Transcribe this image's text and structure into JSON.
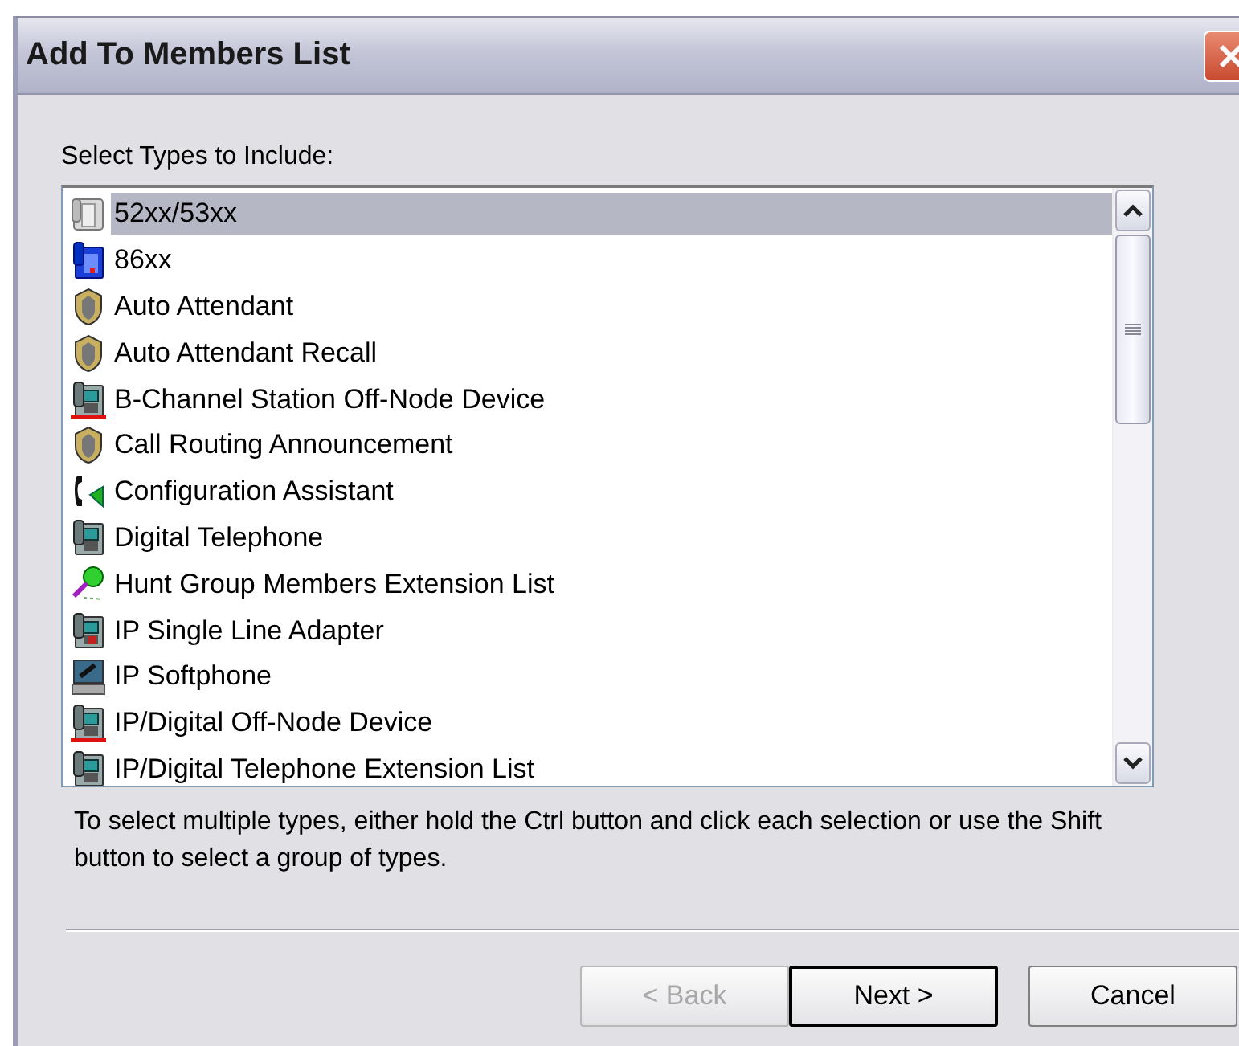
{
  "window": {
    "title": "Add To Members List"
  },
  "list_label": "Select Types to Include:",
  "types": [
    {
      "label": "52xx/53xx",
      "kind": "desk-phone",
      "selected": true
    },
    {
      "label": "86xx",
      "kind": "blue-phone",
      "selected": false
    },
    {
      "label": "Auto Attendant",
      "kind": "shield",
      "selected": false
    },
    {
      "label": "Auto Attendant Recall",
      "kind": "shield",
      "selected": false
    },
    {
      "label": "B-Channel Station Off-Node Device",
      "kind": "off-node",
      "selected": false
    },
    {
      "label": "Call Routing Announcement",
      "kind": "shield",
      "selected": false
    },
    {
      "label": "Configuration Assistant",
      "kind": "handset",
      "selected": false
    },
    {
      "label": "Digital Telephone",
      "kind": "station",
      "selected": false
    },
    {
      "label": "Hunt Group Members Extension List",
      "kind": "pin",
      "selected": false
    },
    {
      "label": "IP Single Line Adapter",
      "kind": "adapter",
      "selected": false
    },
    {
      "label": "IP Softphone",
      "kind": "softphone",
      "selected": false
    },
    {
      "label": "IP/Digital Off-Node Device",
      "kind": "off-node",
      "selected": false
    },
    {
      "label": "IP/Digital Telephone Extension List",
      "kind": "station",
      "selected": false
    }
  ],
  "hint": "To select multiple types, either hold the Ctrl button and click each selection or use the Shift button to select a group of types.",
  "buttons": [
    {
      "label": "< Back",
      "disabled": true,
      "default": false
    },
    {
      "label": "Next >",
      "disabled": false,
      "default": true
    },
    {
      "label": "Cancel",
      "disabled": false,
      "default": false
    }
  ]
}
